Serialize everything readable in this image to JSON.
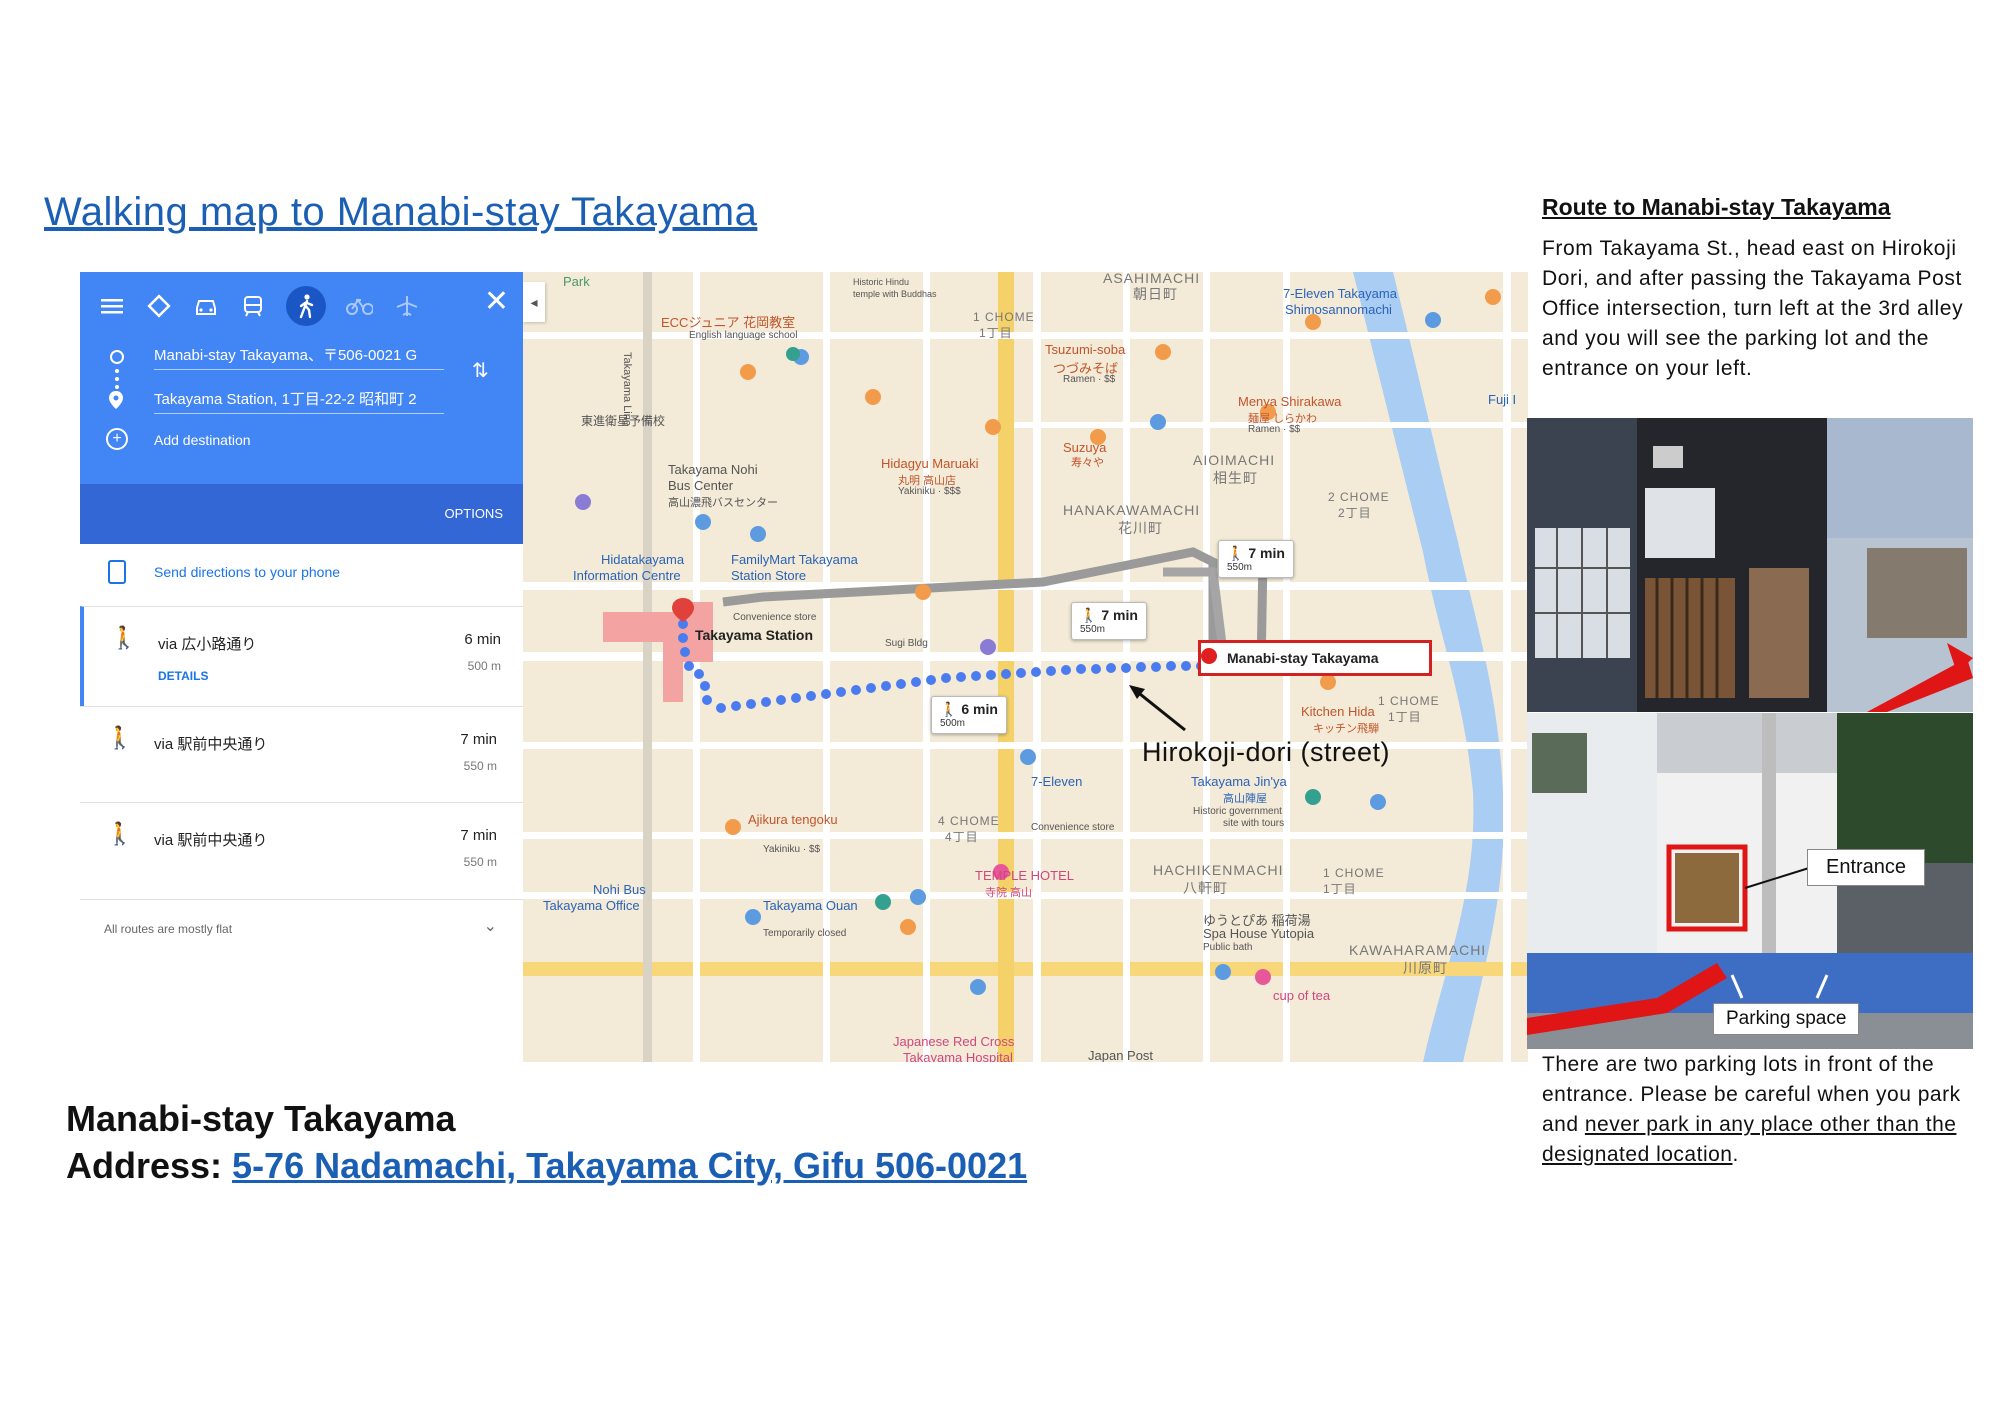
{
  "page_title": "Walking map to Manabi-stay Takayama",
  "directions_panel": {
    "close_icon": "close-icon",
    "origin": "Manabi-stay Takayama、〒506-0021 G",
    "destination": "Takayama Station, 1丁目-22-2 昭和町 2",
    "add_destination": "Add destination",
    "options": "OPTIONS",
    "send_directions": "Send directions to your phone",
    "routes": [
      {
        "via": "via 広小路通り",
        "time": "6 min",
        "distance": "500 m",
        "details": "DETAILS"
      },
      {
        "via": "via 駅前中央通り",
        "time": "7 min",
        "distance": "550 m"
      },
      {
        "via": "via 駅前中央通り",
        "time": "7 min",
        "distance": "550 m"
      }
    ],
    "footer": "All routes are mostly flat"
  },
  "map": {
    "labels": {
      "park": "Park",
      "asahimachi": "ASAHIMACHI",
      "asahimachi_jp": "朝日町",
      "ecc": "ECCジュニア 花岡教室",
      "ecc_sub": "English language school",
      "seven_top": "7-Eleven Takayama",
      "seven_top2": "Shimosannomachi",
      "tsuzumi": "Tsuzumi-soba",
      "tsuzumi_jp": "つづみそば",
      "tsuzumi_sub": "Ramen · $$",
      "menya": "Menya Shirakawa",
      "menya_jp": "麺屋 しらかわ",
      "menya_sub": "Ramen · $$",
      "hindu": "Historic Hindu",
      "hindu2": "temple with Buddhas",
      "chome1": "1 CHOME",
      "chome1_jp": "1丁目",
      "nohi_bus": "Takayama Nohi",
      "nohi_bus2": "Bus Center",
      "nohi_bus_jp": "高山濃飛バスセンター",
      "hidagyu": "Hidagyu Maruaki",
      "hidagyu_jp": "丸明 高山店",
      "hidagyu_sub": "Yakiniku · $$$",
      "suzuya": "Suzuya",
      "suzuya_jp": "寿々や",
      "aioimachi": "AIOIMACHI",
      "aioimachi_jp": "相生町",
      "hanakawamachi": "HANAKAWAMACHI",
      "hanakawamachi_jp": "花川町",
      "chome2": "2 CHOME",
      "chome2_jp": "2丁目",
      "hidatakayama": "Hidatakayama",
      "info_centre": "Information Centre",
      "familymart": "FamilyMart Takayama",
      "familymart2": "Station Store",
      "familymart_sub": "Convenience store",
      "takayama_station": "Takayama Station",
      "sugi": "Sugi Bldg",
      "kitchen_hida": "Kitchen Hida",
      "kitchen_hida_jp": "キッチン飛騨",
      "chome1b": "1 CHOME",
      "chome1b_jp": "1丁目",
      "seven_mid": "7-Eleven",
      "seven_mid_sub": "Convenience store",
      "jinya": "Takayama Jin'ya",
      "jinya_jp": "高山陣屋",
      "jinya_sub": "Historic government",
      "jinya_sub2": "site with tours",
      "ajikura": "Ajikura tengoku",
      "ajikura_sub": "Yakiniku · $$",
      "chome4": "4 CHOME",
      "chome4_jp": "4丁目",
      "temple_hotel": "TEMPLE HOTEL",
      "temple_hotel_jp": "寺院 高山",
      "hachikenmachi": "HACHIKENMACHI",
      "hachikenmachi_jp": "八軒町",
      "chome1c": "1 CHOME",
      "chome1c_jp": "1丁目",
      "kawaharamachi": "KAWAHARAMACHI",
      "kawaharamachi_jp": "川原町",
      "nohi_office": "Nohi Bus",
      "nohi_office2": "Takayama Office",
      "ouan": "Takayama Ouan",
      "ouan_sub": "Temporarily closed",
      "spa": "ゆうとぴあ 稲荷湯",
      "spa2": "Spa House Yutopia",
      "spa_sub": "Public bath",
      "cup_of_tea": "cup of tea",
      "red_cross": "Japanese Red Cross",
      "red_cross2": "Takayama Hospital",
      "japan_post": "Japan Post",
      "takayama_line": "Takayama Line",
      "fuji": "Fuji I"
    },
    "bubbles": [
      {
        "time": "7 min",
        "distance": "550m"
      },
      {
        "time": "7 min",
        "distance": "550m"
      },
      {
        "time": "6 min",
        "distance": "500m"
      }
    ],
    "destination_label": "Manabi-stay Takayama",
    "street_label": "Hirokoji-dori (street)",
    "route_color": "#4a7cf0"
  },
  "right_column": {
    "title": "Route to Manabi-stay Takayama",
    "text": "From Takayama St., head east on Hirokoji Dori, and after passing the Takayama Post Office intersection, turn left at the 3rd alley and you will see the parking lot and the entrance on your left.",
    "entrance_label": "Entrance",
    "parking_label": "Parking space",
    "note_plain": "There are two parking lots in front of the entrance. Please be careful when you park and ",
    "note_underlined": "never park in any place other than the designated location",
    "note_end": "."
  },
  "bottom": {
    "name": "Manabi-stay Takayama",
    "address_label": "Address: ",
    "address_link": "5-76 Nadamachi, Takayama City, Gifu 506-0021"
  }
}
